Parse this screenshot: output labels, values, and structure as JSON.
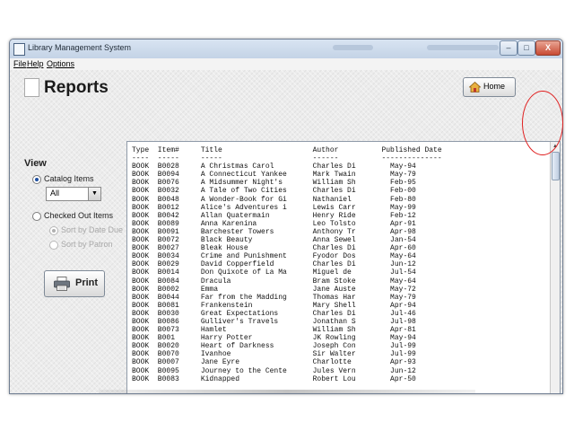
{
  "window": {
    "title": "Library Management System",
    "controls": {
      "minimize": "–",
      "maximize": "□",
      "close": "X"
    }
  },
  "menu": {
    "items": [
      "File",
      "Help",
      "Options"
    ]
  },
  "page": {
    "title": "Reports"
  },
  "home_button": {
    "label": "Home",
    "icon": "home-icon"
  },
  "view_panel": {
    "heading": "View",
    "catalog_items": {
      "label": "Catalog Items",
      "selected": true
    },
    "category_filter": {
      "value": "All"
    },
    "checked_out_items": {
      "label": "Checked Out Items",
      "selected": false
    },
    "sort_by_date_due": {
      "label": "Sort by Date Due",
      "enabled": false,
      "selected": true
    },
    "sort_by_patron": {
      "label": "Sort by Patron",
      "enabled": false,
      "selected": false
    }
  },
  "print_button": {
    "label": "Print",
    "icon": "printer-icon"
  },
  "report": {
    "columns": [
      "Type",
      "Item#",
      "Title",
      "Author",
      "Published Date"
    ],
    "underline": [
      "----",
      "-----",
      "-----",
      "------",
      "--------------"
    ],
    "rows": [
      [
        "BOOK",
        "B0028",
        "A Christmas Carol",
        "Charles Di",
        "May-94"
      ],
      [
        "BOOK",
        "B0094",
        "A Connecticut Yankee",
        "Mark Twain",
        "May-79"
      ],
      [
        "BOOK",
        "B0076",
        "A Midsummer Night's",
        "William Sh",
        "Feb-95"
      ],
      [
        "BOOK",
        "B0032",
        "A Tale of Two Cities",
        "Charles Di",
        "Feb-00"
      ],
      [
        "BOOK",
        "B0048",
        "A Wonder-Book for Gi",
        "Nathaniel",
        "Feb-80"
      ],
      [
        "BOOK",
        "B0012",
        "Alice's Adventures i",
        "Lewis Carr",
        "May-99"
      ],
      [
        "BOOK",
        "B0042",
        "Allan Quatermain",
        "Henry Ride",
        "Feb-12"
      ],
      [
        "BOOK",
        "B0089",
        "Anna Karenina",
        "Leo Tolsto",
        "Apr-91"
      ],
      [
        "BOOK",
        "B0091",
        "Barchester Towers",
        "Anthony Tr",
        "Apr-98"
      ],
      [
        "BOOK",
        "B0072",
        "Black Beauty",
        "Anna Sewel",
        "Jan-54"
      ],
      [
        "BOOK",
        "B0027",
        "Bleak House",
        "Charles Di",
        "Apr-60"
      ],
      [
        "BOOK",
        "B0034",
        "Crime and Punishment",
        "Fyodor Dos",
        "May-64"
      ],
      [
        "BOOK",
        "B0029",
        "David Copperfield",
        "Charles Di",
        "Jun-12"
      ],
      [
        "BOOK",
        "B0014",
        "Don Quixote of La Ma",
        "Miguel de",
        "Jul-54"
      ],
      [
        "BOOK",
        "B0084",
        "Dracula",
        "Bram Stoke",
        "May-64"
      ],
      [
        "BOOK",
        "B0002",
        "Emma",
        "Jane Auste",
        "May-72"
      ],
      [
        "BOOK",
        "B0044",
        "Far from the Madding",
        "Thomas Har",
        "May-79"
      ],
      [
        "BOOK",
        "B0081",
        "Frankenstein",
        "Mary Shell",
        "Apr-94"
      ],
      [
        "BOOK",
        "B0030",
        "Great Expectations",
        "Charles Di",
        "Jul-46"
      ],
      [
        "BOOK",
        "B0086",
        "Gulliver's Travels",
        "Jonathan S",
        "Jul-98"
      ],
      [
        "BOOK",
        "B0073",
        "Hamlet",
        "William Sh",
        "Apr-81"
      ],
      [
        "BOOK",
        "B001",
        "Harry Potter",
        "JK Rowling",
        "May-94"
      ],
      [
        "BOOK",
        "B0020",
        "Heart of Darkness",
        "Joseph Con",
        "Jul-99"
      ],
      [
        "BOOK",
        "B0070",
        "Ivanhoe",
        "Sir Walter",
        "Jul-99"
      ],
      [
        "BOOK",
        "B0007",
        "Jane Eyre",
        "Charlotte",
        "Apr-93"
      ],
      [
        "BOOK",
        "B0095",
        "Journey to the Cente",
        "Jules Vern",
        "Jun-12"
      ],
      [
        "BOOK",
        "B0083",
        "Kidnapped",
        "Robert Lou",
        "Apr-50"
      ]
    ]
  },
  "colors": {
    "annotation": "#e02020",
    "selection": "#1e4fa0"
  }
}
